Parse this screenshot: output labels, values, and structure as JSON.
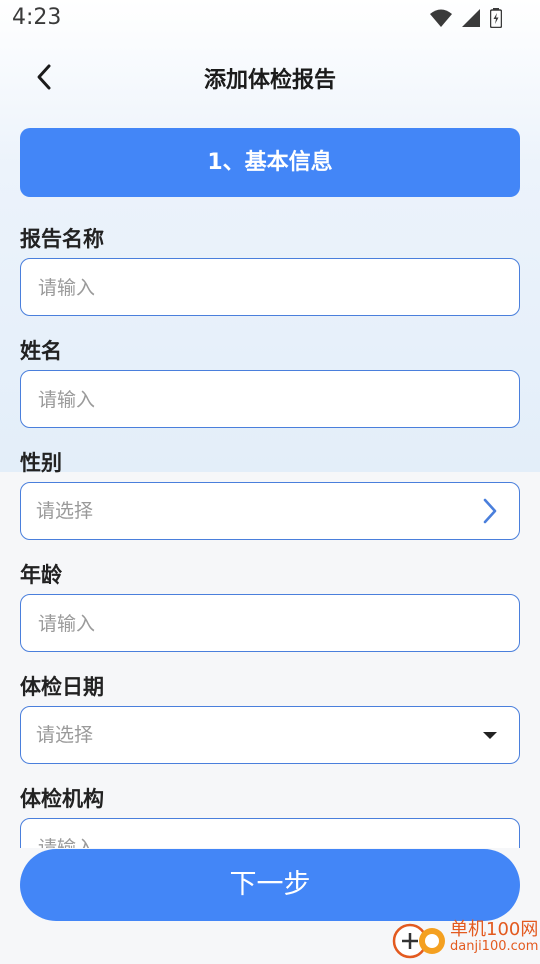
{
  "status_bar": {
    "time": "4:23"
  },
  "nav": {
    "title": "添加体检报告"
  },
  "step": {
    "label": "1、基本信息"
  },
  "fields": [
    {
      "label": "报告名称",
      "placeholder": "请输入"
    },
    {
      "label": "姓名",
      "placeholder": "请输入"
    },
    {
      "label": "性别",
      "placeholder": "请选择"
    },
    {
      "label": "年龄",
      "placeholder": "请输入"
    },
    {
      "label": "体检日期",
      "placeholder": "请选择"
    },
    {
      "label": "体检机构",
      "placeholder": "请输入"
    }
  ],
  "footer": {
    "next_label": "下一步"
  },
  "watermark": {
    "cn": "单机100网",
    "en": "danji100.com"
  },
  "colors": {
    "accent": "#4386f7",
    "border": "#4a7fdc"
  },
  "icons": {
    "back": "chevron-left-icon",
    "gender_select": "chevron-right-icon",
    "date_select": "caret-down-icon"
  }
}
